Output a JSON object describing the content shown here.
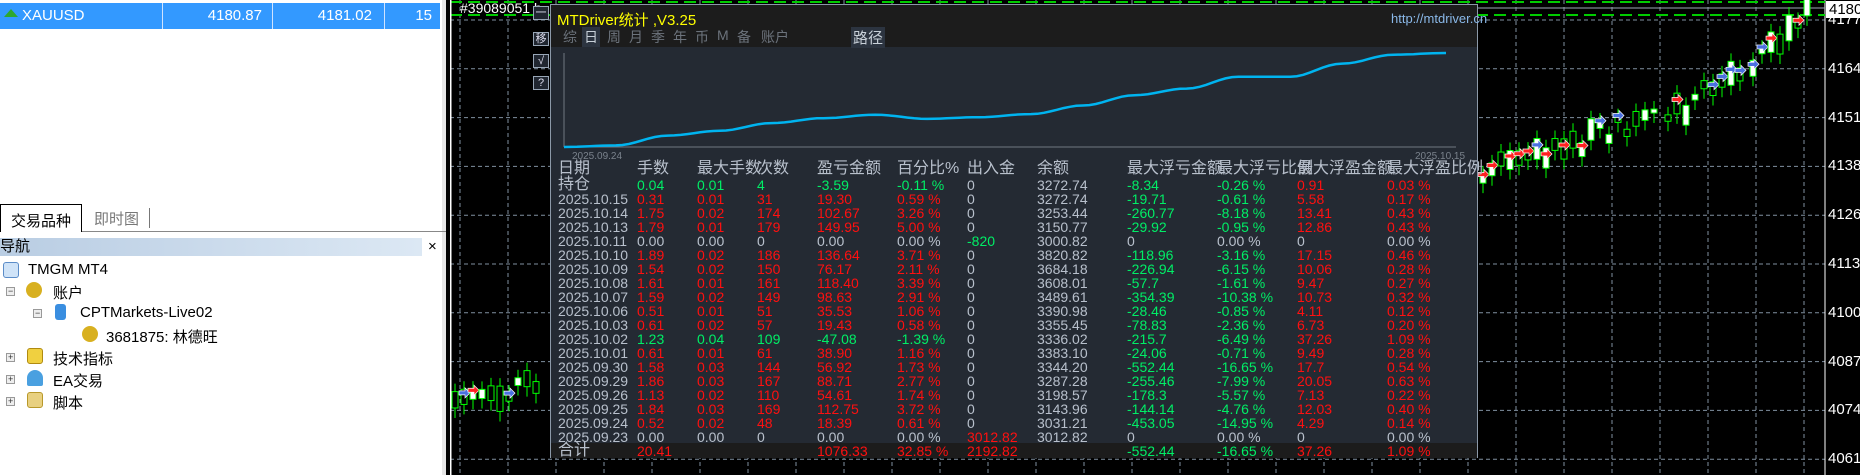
{
  "market_watch": {
    "symbol": "XAUUSD",
    "bid": "4180.87",
    "ask": "4181.02",
    "spread": "15",
    "trend_icon": "green-up-arrow"
  },
  "left_tabs": [
    "交易品种",
    "即时图"
  ],
  "navigator": {
    "title": "导航",
    "close": "×",
    "items": [
      "TMGM MT4",
      "账户",
      "CPTMarkets-Live02",
      "3681875: 林德旺",
      "技术指标",
      "EA交易",
      "脚本"
    ]
  },
  "chart": {
    "order_label": "#39089051 b",
    "current_price": "4180",
    "price_labels": [
      "4177",
      "4164",
      "4151",
      "4138",
      "4126",
      "4113",
      "4100",
      "4087",
      "4074",
      "4061"
    ],
    "colors": {
      "background": "#000000",
      "candle_up": "#00ff00",
      "grid": "#8090a0",
      "order_line": "#00cc00"
    }
  },
  "side_buttons": [
    "一",
    "移",
    "√",
    "?"
  ],
  "panel": {
    "title": "MTDriver统计 ,V3.25",
    "url": "http://mtdriver.cn",
    "tabs": [
      "综",
      "日",
      "周",
      "月",
      "季",
      "年",
      "币",
      "M",
      "备",
      "账户"
    ],
    "active_tab": "日",
    "path_button": "路径",
    "mini_chart": {
      "start_label": "2025.09.24",
      "end_label": "2025.10.15",
      "line_color": "#00b4f0"
    },
    "headers": [
      "日期",
      "手数",
      "最大手数",
      "次数",
      "盈亏金额",
      "百分比%",
      "出入金",
      "余额",
      "最大浮亏金额",
      "最大浮亏比例",
      "最大浮盈金额",
      "最大浮盈比例"
    ],
    "rows": [
      [
        [
          "持仓",
          "n"
        ],
        [
          "0.04",
          "g"
        ],
        [
          "0.01",
          "g"
        ],
        [
          "4",
          "g"
        ],
        [
          "-3.59",
          "g"
        ],
        [
          "-0.11 %",
          "g"
        ],
        [
          "0",
          "n"
        ],
        [
          "3272.74",
          "n"
        ],
        [
          "-8.34",
          "g"
        ],
        [
          "-0.26 %",
          "g"
        ],
        [
          "0.91",
          "r"
        ],
        [
          "0.03 %",
          "r"
        ]
      ],
      [
        [
          "2025.10.15",
          "n"
        ],
        [
          "0.31",
          "r"
        ],
        [
          "0.01",
          "r"
        ],
        [
          "31",
          "r"
        ],
        [
          "19.30",
          "r"
        ],
        [
          "0.59 %",
          "r"
        ],
        [
          "0",
          "n"
        ],
        [
          "3272.74",
          "n"
        ],
        [
          "-19.71",
          "g"
        ],
        [
          "-0.61 %",
          "g"
        ],
        [
          "5.58",
          "r"
        ],
        [
          "0.17 %",
          "r"
        ]
      ],
      [
        [
          "2025.10.14",
          "n"
        ],
        [
          "1.75",
          "r"
        ],
        [
          "0.02",
          "r"
        ],
        [
          "174",
          "r"
        ],
        [
          "102.67",
          "r"
        ],
        [
          "3.26 %",
          "r"
        ],
        [
          "0",
          "n"
        ],
        [
          "3253.44",
          "n"
        ],
        [
          "-260.77",
          "g"
        ],
        [
          "-8.18 %",
          "g"
        ],
        [
          "13.41",
          "r"
        ],
        [
          "0.43 %",
          "r"
        ]
      ],
      [
        [
          "2025.10.13",
          "n"
        ],
        [
          "1.79",
          "r"
        ],
        [
          "0.01",
          "r"
        ],
        [
          "179",
          "r"
        ],
        [
          "149.95",
          "r"
        ],
        [
          "5.00 %",
          "r"
        ],
        [
          "0",
          "n"
        ],
        [
          "3150.77",
          "n"
        ],
        [
          "-29.92",
          "g"
        ],
        [
          "-0.95 %",
          "g"
        ],
        [
          "12.86",
          "r"
        ],
        [
          "0.43 %",
          "r"
        ]
      ],
      [
        [
          "2025.10.11",
          "n"
        ],
        [
          "0.00",
          "n"
        ],
        [
          "0.00",
          "n"
        ],
        [
          "0",
          "n"
        ],
        [
          "0.00",
          "n"
        ],
        [
          "0.00 %",
          "n"
        ],
        [
          "-820",
          "g"
        ],
        [
          "3000.82",
          "n"
        ],
        [
          "0",
          "n"
        ],
        [
          "0.00 %",
          "n"
        ],
        [
          "0",
          "n"
        ],
        [
          "0.00 %",
          "n"
        ]
      ],
      [
        [
          "2025.10.10",
          "n"
        ],
        [
          "1.89",
          "r"
        ],
        [
          "0.02",
          "r"
        ],
        [
          "186",
          "r"
        ],
        [
          "136.64",
          "r"
        ],
        [
          "3.71 %",
          "r"
        ],
        [
          "0",
          "n"
        ],
        [
          "3820.82",
          "n"
        ],
        [
          "-118.96",
          "g"
        ],
        [
          "-3.16 %",
          "g"
        ],
        [
          "17.15",
          "r"
        ],
        [
          "0.46 %",
          "r"
        ]
      ],
      [
        [
          "2025.10.09",
          "n"
        ],
        [
          "1.54",
          "r"
        ],
        [
          "0.02",
          "r"
        ],
        [
          "150",
          "r"
        ],
        [
          "76.17",
          "r"
        ],
        [
          "2.11 %",
          "r"
        ],
        [
          "0",
          "n"
        ],
        [
          "3684.18",
          "n"
        ],
        [
          "-226.94",
          "g"
        ],
        [
          "-6.15 %",
          "g"
        ],
        [
          "10.06",
          "r"
        ],
        [
          "0.28 %",
          "r"
        ]
      ],
      [
        [
          "2025.10.08",
          "n"
        ],
        [
          "1.61",
          "r"
        ],
        [
          "0.01",
          "r"
        ],
        [
          "161",
          "r"
        ],
        [
          "118.40",
          "r"
        ],
        [
          "3.39 %",
          "r"
        ],
        [
          "0",
          "n"
        ],
        [
          "3608.01",
          "n"
        ],
        [
          "-57.7",
          "g"
        ],
        [
          "-1.61 %",
          "g"
        ],
        [
          "9.47",
          "r"
        ],
        [
          "0.27 %",
          "r"
        ]
      ],
      [
        [
          "2025.10.07",
          "n"
        ],
        [
          "1.59",
          "r"
        ],
        [
          "0.02",
          "r"
        ],
        [
          "149",
          "r"
        ],
        [
          "98.63",
          "r"
        ],
        [
          "2.91 %",
          "r"
        ],
        [
          "0",
          "n"
        ],
        [
          "3489.61",
          "n"
        ],
        [
          "-354.39",
          "g"
        ],
        [
          "-10.38 %",
          "g"
        ],
        [
          "10.73",
          "r"
        ],
        [
          "0.32 %",
          "r"
        ]
      ],
      [
        [
          "2025.10.06",
          "n"
        ],
        [
          "0.51",
          "r"
        ],
        [
          "0.01",
          "r"
        ],
        [
          "51",
          "r"
        ],
        [
          "35.53",
          "r"
        ],
        [
          "1.06 %",
          "r"
        ],
        [
          "0",
          "n"
        ],
        [
          "3390.98",
          "n"
        ],
        [
          "-28.46",
          "g"
        ],
        [
          "-0.85 %",
          "g"
        ],
        [
          "4.11",
          "r"
        ],
        [
          "0.12 %",
          "r"
        ]
      ],
      [
        [
          "2025.10.03",
          "n"
        ],
        [
          "0.61",
          "r"
        ],
        [
          "0.02",
          "r"
        ],
        [
          "57",
          "r"
        ],
        [
          "19.43",
          "r"
        ],
        [
          "0.58 %",
          "r"
        ],
        [
          "0",
          "n"
        ],
        [
          "3355.45",
          "n"
        ],
        [
          "-78.83",
          "g"
        ],
        [
          "-2.36 %",
          "g"
        ],
        [
          "6.73",
          "r"
        ],
        [
          "0.20 %",
          "r"
        ]
      ],
      [
        [
          "2025.10.02",
          "n"
        ],
        [
          "1.23",
          "g"
        ],
        [
          "0.04",
          "g"
        ],
        [
          "109",
          "g"
        ],
        [
          "-47.08",
          "g"
        ],
        [
          "-1.39 %",
          "g"
        ],
        [
          "0",
          "n"
        ],
        [
          "3336.02",
          "n"
        ],
        [
          "-215.7",
          "g"
        ],
        [
          "-6.49 %",
          "g"
        ],
        [
          "37.26",
          "r"
        ],
        [
          "1.09 %",
          "r"
        ]
      ],
      [
        [
          "2025.10.01",
          "n"
        ],
        [
          "0.61",
          "r"
        ],
        [
          "0.01",
          "r"
        ],
        [
          "61",
          "r"
        ],
        [
          "38.90",
          "r"
        ],
        [
          "1.16 %",
          "r"
        ],
        [
          "0",
          "n"
        ],
        [
          "3383.10",
          "n"
        ],
        [
          "-24.06",
          "g"
        ],
        [
          "-0.71 %",
          "g"
        ],
        [
          "9.49",
          "r"
        ],
        [
          "0.28 %",
          "r"
        ]
      ],
      [
        [
          "2025.09.30",
          "n"
        ],
        [
          "1.58",
          "r"
        ],
        [
          "0.03",
          "r"
        ],
        [
          "144",
          "r"
        ],
        [
          "56.92",
          "r"
        ],
        [
          "1.73 %",
          "r"
        ],
        [
          "0",
          "n"
        ],
        [
          "3344.20",
          "n"
        ],
        [
          "-552.44",
          "g"
        ],
        [
          "-16.65 %",
          "g"
        ],
        [
          "17.7",
          "r"
        ],
        [
          "0.54 %",
          "r"
        ]
      ],
      [
        [
          "2025.09.29",
          "n"
        ],
        [
          "1.86",
          "r"
        ],
        [
          "0.03",
          "r"
        ],
        [
          "167",
          "r"
        ],
        [
          "88.71",
          "r"
        ],
        [
          "2.77 %",
          "r"
        ],
        [
          "0",
          "n"
        ],
        [
          "3287.28",
          "n"
        ],
        [
          "-255.46",
          "g"
        ],
        [
          "-7.99 %",
          "g"
        ],
        [
          "20.05",
          "r"
        ],
        [
          "0.63 %",
          "r"
        ]
      ],
      [
        [
          "2025.09.26",
          "n"
        ],
        [
          "1.13",
          "r"
        ],
        [
          "0.02",
          "r"
        ],
        [
          "110",
          "r"
        ],
        [
          "54.61",
          "r"
        ],
        [
          "1.74 %",
          "r"
        ],
        [
          "0",
          "n"
        ],
        [
          "3198.57",
          "n"
        ],
        [
          "-178.3",
          "g"
        ],
        [
          "-5.57 %",
          "g"
        ],
        [
          "7.13",
          "r"
        ],
        [
          "0.22 %",
          "r"
        ]
      ],
      [
        [
          "2025.09.25",
          "n"
        ],
        [
          "1.84",
          "r"
        ],
        [
          "0.03",
          "r"
        ],
        [
          "169",
          "r"
        ],
        [
          "112.75",
          "r"
        ],
        [
          "3.72 %",
          "r"
        ],
        [
          "0",
          "n"
        ],
        [
          "3143.96",
          "n"
        ],
        [
          "-144.14",
          "g"
        ],
        [
          "-4.76 %",
          "g"
        ],
        [
          "12.03",
          "r"
        ],
        [
          "0.40 %",
          "r"
        ]
      ],
      [
        [
          "2025.09.24",
          "n"
        ],
        [
          "0.52",
          "r"
        ],
        [
          "0.02",
          "r"
        ],
        [
          "48",
          "r"
        ],
        [
          "18.39",
          "r"
        ],
        [
          "0.61 %",
          "r"
        ],
        [
          "0",
          "n"
        ],
        [
          "3031.21",
          "n"
        ],
        [
          "-453.05",
          "g"
        ],
        [
          "-14.95 %",
          "g"
        ],
        [
          "4.29",
          "r"
        ],
        [
          "0.14 %",
          "r"
        ]
      ],
      [
        [
          "2025.09.23",
          "n"
        ],
        [
          "0.00",
          "n"
        ],
        [
          "0.00",
          "n"
        ],
        [
          "0",
          "n"
        ],
        [
          "0.00",
          "n"
        ],
        [
          "0.00 %",
          "n"
        ],
        [
          "3012.82",
          "r"
        ],
        [
          "3012.82",
          "n"
        ],
        [
          "0",
          "n"
        ],
        [
          "0.00 %",
          "n"
        ],
        [
          "0",
          "n"
        ],
        [
          "0.00 %",
          "n"
        ]
      ]
    ],
    "total": [
      [
        "合计",
        "n"
      ],
      [
        "20.41",
        "r"
      ],
      [
        "",
        ""
      ],
      [
        "",
        ""
      ],
      [
        "1076.33",
        "r"
      ],
      [
        "32.85 %",
        "r"
      ],
      [
        "2192.82",
        "r"
      ],
      [
        "",
        ""
      ],
      [
        "-552.44",
        "g"
      ],
      [
        "-16.65 %",
        "g"
      ],
      [
        "37.26",
        "r"
      ],
      [
        "1.09 %",
        "r"
      ]
    ],
    "colors": {
      "profit": "#ff1010",
      "loss": "#00ee66",
      "neutral": "#b8c0cc",
      "title": "#ffff00"
    }
  }
}
